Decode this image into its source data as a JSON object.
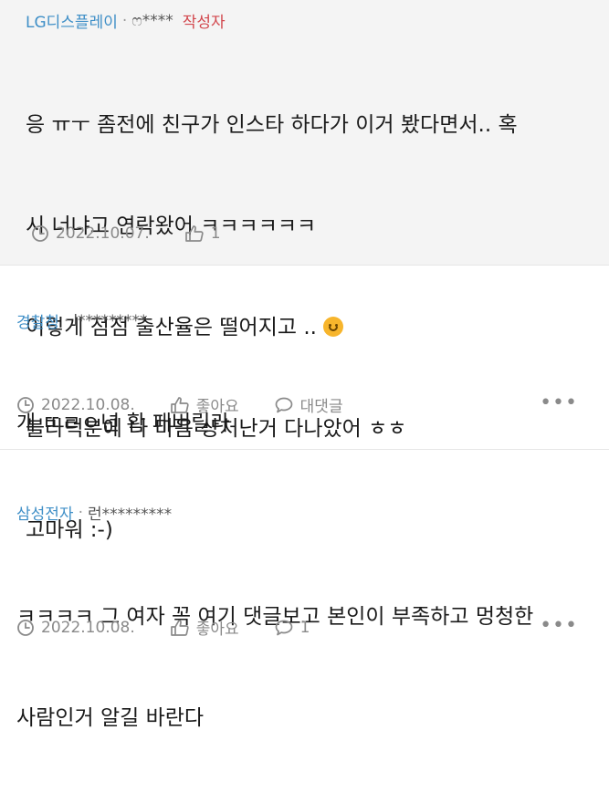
{
  "comments": [
    {
      "company": "LG디스플레이",
      "nickname": "ෆ****",
      "author_tag": "작성자",
      "lines": [
        "응 ㅠㅜ 좀전에 친구가 인스타 하다가 이거 봤다면서.. 혹",
        "시 너냐고 연락왔어 ㅋㅋㅋㅋㅋㅋ",
        "이렇게 점점 출산율은 떨어지고 .. ",
        "블라덕분에 나 마음 상처난거 다나았어 ㅎㅎ",
        "고마워 :-)"
      ],
      "date": "2022.10.07.",
      "likes": "1"
    },
    {
      "company": "경찰청",
      "nickname": "l*********",
      "lines": [
        "개 ㄸㄹㅇ년 확 패버릴라"
      ],
      "date": "2022.10.08.",
      "like_label": "좋아요",
      "reply_label": "대댓글",
      "more": "•••"
    },
    {
      "company": "삼성전자",
      "nickname": "런*********",
      "lines": [
        "ㅋㅋㅋㅋ 그 여자 꼭 여기 댓글보고 본인이 부족하고 멍청한",
        "사람인거 알길 바란다"
      ],
      "date": "2022.10.08.",
      "like_label": "좋아요",
      "reply_count": "1",
      "more": "•••"
    }
  ]
}
